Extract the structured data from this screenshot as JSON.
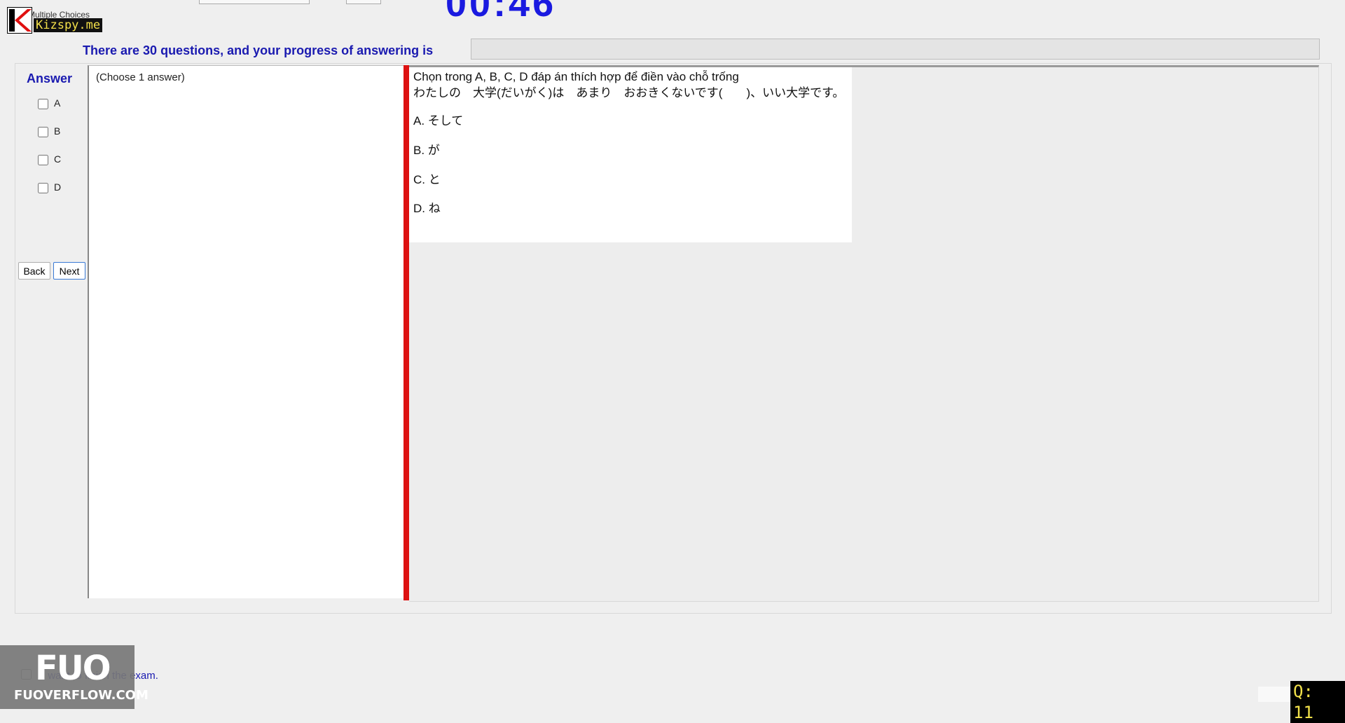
{
  "window": {
    "tab_label": "Multiple Choices",
    "timer_partial": "00:46"
  },
  "watermark": {
    "site": "Kizspy.me",
    "footer_logo_big": "FUO",
    "footer_logo_small": "FUOVERFLOW.COM"
  },
  "progress": {
    "label": "There are 30 questions, and your progress of answering is",
    "fraction": 0
  },
  "answer": {
    "title": "Answer",
    "options": [
      "A",
      "B",
      "C",
      "D"
    ],
    "hint": "(Choose 1 answer)"
  },
  "navigation": {
    "back_label": "Back",
    "next_label": "Next"
  },
  "question": {
    "instruction": "Chọn trong A, B, C, D đáp án thích hợp để điền vào chỗ trống",
    "sentence": "わたしの　大学(だいがく)は　あまり　おおきくないです(　　)、いい大学です。",
    "choices": [
      "A.  そして",
      "B.  が",
      "C.  と",
      "D.  ね"
    ]
  },
  "footer": {
    "finish_label": "I want to finish the exam.",
    "question_indicator": "Q: 11"
  }
}
